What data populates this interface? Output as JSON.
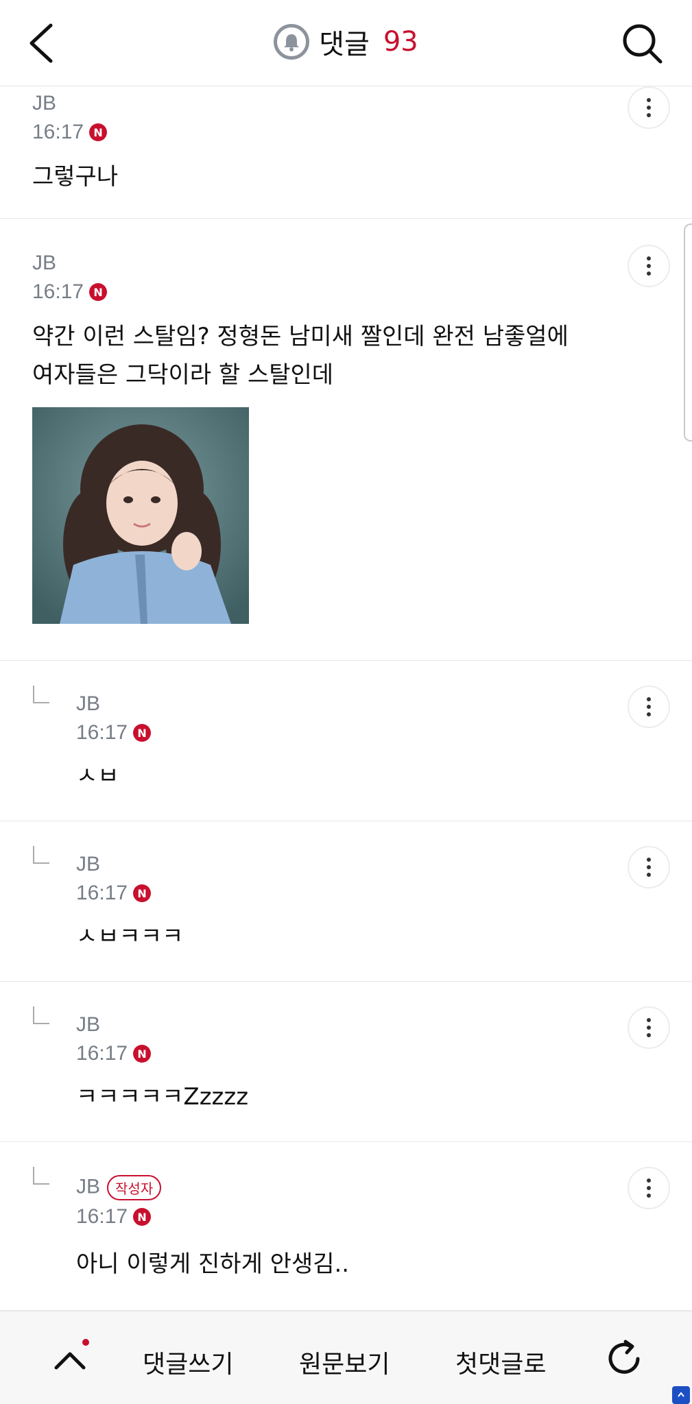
{
  "header": {
    "title": "댓글",
    "count": "93"
  },
  "comments": [
    {
      "author": "JB",
      "time": "16:17",
      "badge": "N",
      "text": "그렇구나"
    },
    {
      "author": "JB",
      "time": "16:17",
      "badge": "N",
      "text_line1": "약간 이런 스탈임? 정형돈 남미새 짤인데 완전 남좋얼에",
      "text_line2": "여자들은 그닥이라 할 스탈인데"
    },
    {
      "author": "JB",
      "time": "16:17",
      "badge": "N",
      "text": "ㅅㅂ"
    },
    {
      "author": "JB",
      "time": "16:17",
      "badge": "N",
      "text": "ㅅㅂㅋㅋㅋ"
    },
    {
      "author": "JB",
      "time": "16:17",
      "badge": "N",
      "text": "ㅋㅋㅋㅋㅋZzzzz"
    },
    {
      "author": "JB",
      "author_badge": "작성자",
      "time": "16:17",
      "badge": "N",
      "text": "아니 이렇게 진하게 안생김.."
    }
  ],
  "bottom_bar": {
    "write_comment": "댓글쓰기",
    "view_original": "원문보기",
    "first_comment": "첫댓글로"
  },
  "colors": {
    "accent": "#c8102e",
    "meta_text": "#777d86",
    "divider": "#e6e6e6"
  },
  "icons": {
    "back": "chevron-left-icon",
    "bell": "bell-icon",
    "search": "search-icon",
    "more": "more-vertical-icon",
    "up": "chevron-up-icon",
    "refresh": "refresh-icon"
  }
}
